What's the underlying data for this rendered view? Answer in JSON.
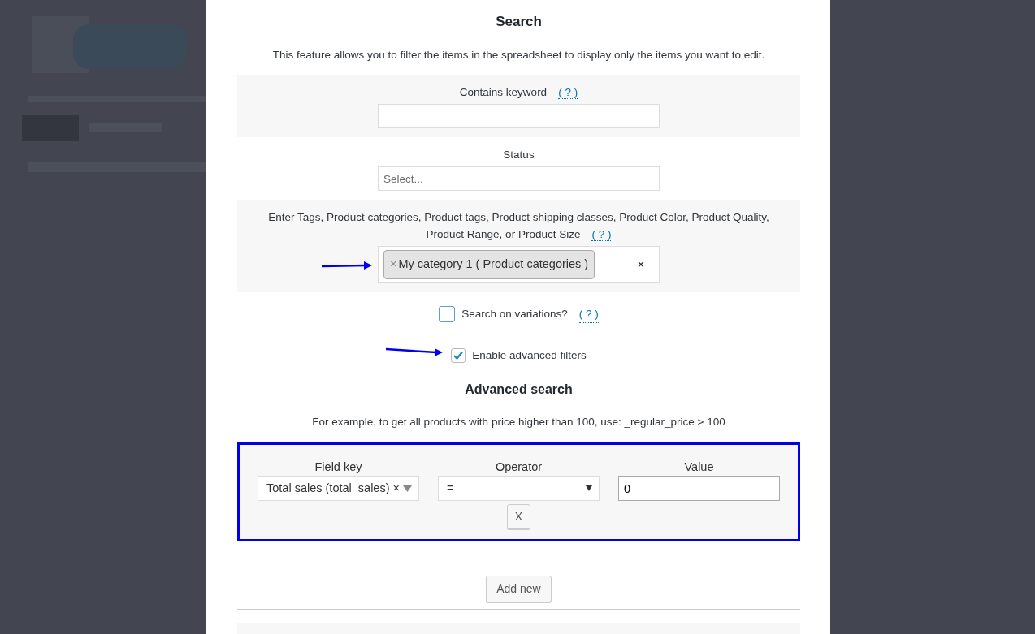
{
  "dialog": {
    "title": "Search",
    "description": "This feature allows you to filter the items in the spreadsheet to display only the items you want to edit."
  },
  "fields": [
    {
      "kind": "text",
      "label": "Contains keyword",
      "help": "( ? )"
    },
    {
      "kind": "select",
      "label": "Status",
      "placeholder": "Select..."
    },
    {
      "kind": "tags",
      "label": "Enter Tags, Product categories, Product tags, Product shipping classes, Product Color, Product Quality, Product Range, or Product Size",
      "help": "( ? )",
      "tags": [
        {
          "remove": "×",
          "text": "My category 1 ( Product categories )"
        }
      ],
      "clear": "×",
      "annotated": true
    }
  ],
  "checkboxes": [
    {
      "label": "Search on variations?",
      "help": "( ? )",
      "checked": false
    },
    {
      "label": "Enable advanced filters",
      "checked": true,
      "annotated": true
    }
  ],
  "advanced": {
    "title": "Advanced search",
    "hint": "For example, to get all products with price higher than 100, use: _regular_price > 100",
    "highlighted": true,
    "columns": [
      "Field key",
      "Operator",
      "Value"
    ],
    "rules": [
      {
        "field_key": "Total sales (total_sales)",
        "field_clear": "×",
        "operator": "=",
        "value": "0",
        "remove": "X"
      }
    ],
    "add_button": "Add new"
  }
}
